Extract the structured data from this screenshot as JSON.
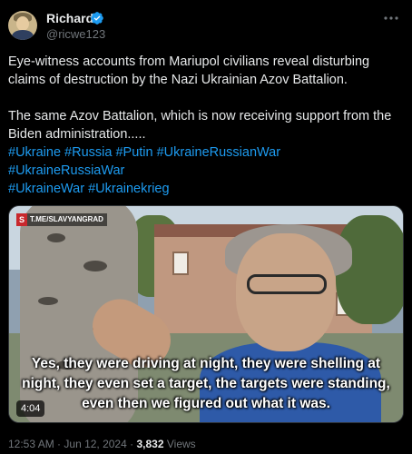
{
  "author": {
    "name": "Richard",
    "handle": "@ricwe123",
    "verified_color": "#1d9bf0"
  },
  "tweet": {
    "line1": "Eye-witness accounts from Mariupol civilians reveal disturbing claims of destruction by the Nazi Ukrainian Azov Battalion.",
    "line2": "The same Azov Battalion, which is now receiving support from the Biden administration.....",
    "hashtags": [
      "#Ukraine #Russia #Putin #UkraineRussianWar",
      "#UkraineRussiaWar",
      "#UkraineWar #Ukrainekrieg"
    ]
  },
  "video": {
    "watermark_letter": "S",
    "watermark_text": "T.ME/SLAVYANGRAD",
    "subtitle": "Yes, they were driving at night, they were shelling at night, they even set a target, the targets were standing, even then we figured out what it was.",
    "duration": "4:04"
  },
  "meta": {
    "time": "12:53 AM",
    "separator": "·",
    "date": "Jun 12, 2024",
    "views_count": "3,832",
    "views_label": "Views"
  },
  "colors": {
    "background": "#000000",
    "text": "#e7e9ea",
    "secondary": "#71767b",
    "link": "#1d9bf0"
  },
  "icons": [
    "verified-badge-icon",
    "more-options-icon"
  ]
}
